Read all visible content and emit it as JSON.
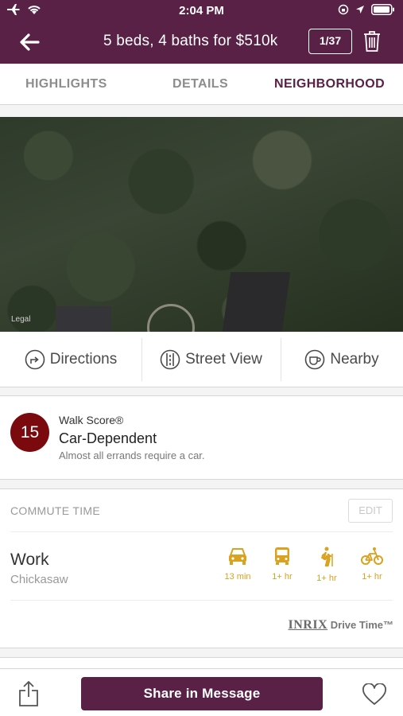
{
  "status_bar": {
    "time": "2:04 PM"
  },
  "header": {
    "title": "5 beds, 4 baths for $510k",
    "photo_count": "1/37"
  },
  "tabs": [
    {
      "label": "HIGHLIGHTS",
      "active": false
    },
    {
      "label": "DETAILS",
      "active": false
    },
    {
      "label": "NEIGHBORHOOD",
      "active": true
    }
  ],
  "map": {
    "legal_label": "Legal"
  },
  "actions": {
    "directions": "Directions",
    "street_view": "Street View",
    "nearby": "Nearby"
  },
  "walk_score": {
    "score": "15",
    "label": "Walk Score®",
    "category": "Car-Dependent",
    "description": "Almost all errands require a car."
  },
  "commute": {
    "title": "COMMUTE TIME",
    "edit_label": "EDIT",
    "destination_name": "Work",
    "destination_place": "Chickasaw",
    "modes": [
      {
        "mode": "car-icon",
        "time": "13 min"
      },
      {
        "mode": "bus-icon",
        "time": "1+ hr"
      },
      {
        "mode": "walk-icon",
        "time": "1+ hr"
      },
      {
        "mode": "bike-icon",
        "time": "1+ hr"
      }
    ],
    "provider_brand": "INRIX",
    "provider_suffix": "Drive Time™"
  },
  "bottom_bar": {
    "share_label": "Share in Message"
  },
  "colors": {
    "brand": "#5a2147",
    "accent": "#d9a21f",
    "score": "#7a0a0e"
  }
}
